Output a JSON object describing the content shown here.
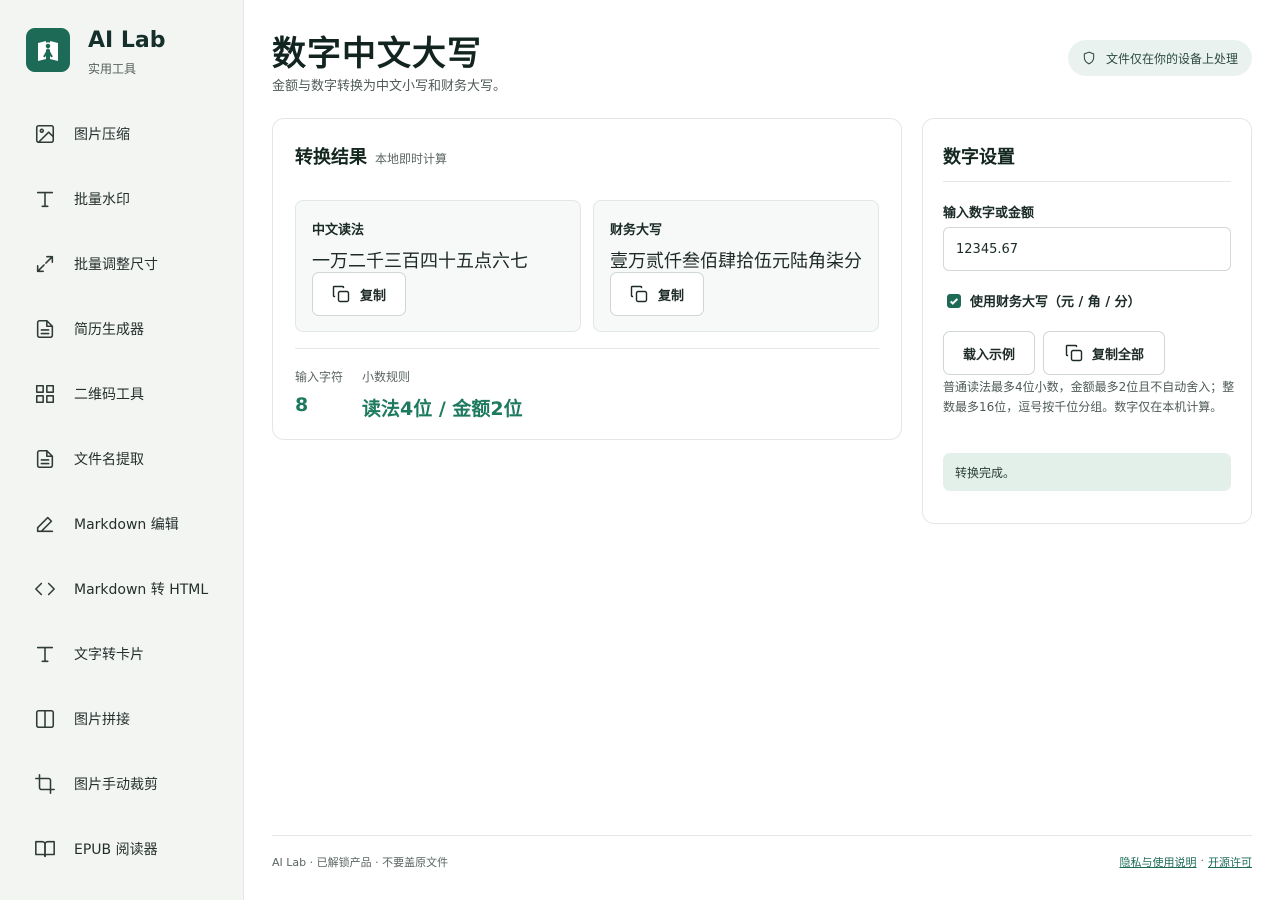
{
  "brand": {
    "name": "AI Lab",
    "subtitle": "实用工具"
  },
  "sidebar": {
    "items": [
      {
        "label": "图片压缩",
        "icon": "image-icon"
      },
      {
        "label": "批量水印",
        "icon": "text-icon"
      },
      {
        "label": "批量调整尺寸",
        "icon": "resize-icon"
      },
      {
        "label": "简历生成器",
        "icon": "document-icon"
      },
      {
        "label": "二维码工具",
        "icon": "grid-icon"
      },
      {
        "label": "文件名提取",
        "icon": "document-icon"
      },
      {
        "label": "Markdown 编辑",
        "icon": "pen-icon"
      },
      {
        "label": "Markdown 转 HTML",
        "icon": "code-icon"
      },
      {
        "label": "文字转卡片",
        "icon": "text-icon"
      },
      {
        "label": "图片拼接",
        "icon": "columns-icon"
      },
      {
        "label": "图片手动裁剪",
        "icon": "crop-icon"
      },
      {
        "label": "EPUB 阅读器",
        "icon": "book-icon"
      }
    ]
  },
  "header": {
    "title": "数字中文大写",
    "subtitle": "金额与数字转换为中文小写和财务大写。",
    "privacy_badge": "文件仅在你的设备上处理"
  },
  "result": {
    "title": "转换结果",
    "tag": "本地即时计算",
    "chinese": {
      "label": "中文读法",
      "value": "一万二千三百四十五点六七",
      "copy_label": "复制"
    },
    "finance": {
      "label": "财务大写",
      "value": "壹万贰仟叁佰肆拾伍元陆角柒分",
      "copy_label": "复制"
    },
    "stats": [
      {
        "label": "输入字符",
        "value": "8"
      },
      {
        "label": "小数规则",
        "value": "读法4位 / 金额2位"
      }
    ]
  },
  "settings": {
    "title": "数字设置",
    "input_label": "输入数字或金额",
    "input_value": "12345.67",
    "checkbox_label": "使用财务大写（元 / 角 / 分）",
    "load_example_label": "载入示例",
    "copy_all_label": "复制全部",
    "help_text": "普通读法最多4位小数，金额最多2位且不自动舍入；整数最多16位，逗号按千位分组。数字仅在本机计算。",
    "status_text": "转换完成。"
  },
  "footer": {
    "left": "AI Lab · 已解锁产品 · 不要盖原文件",
    "privacy_link": "隐私与使用说明",
    "separator": "·",
    "license_link": "开源许可"
  },
  "colors": {
    "accent": "#1d6b57",
    "accent_text": "#1d7a5e",
    "status_bg": "#e3f0e9",
    "sidebar_bg": "#f3f5f3"
  }
}
